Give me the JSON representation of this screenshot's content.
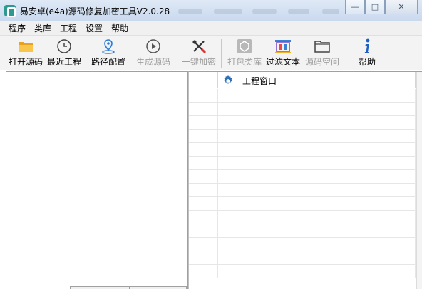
{
  "window": {
    "title": "易安卓(e4a)源码修复加密工具V2.0.28",
    "buttons": {
      "minimize": "—",
      "restore": "□",
      "close": "✕"
    }
  },
  "menu": [
    "程序",
    "类库",
    "工程",
    "设置",
    "帮助"
  ],
  "toolbar": [
    {
      "label": "打开源码",
      "icon": "folder-icon",
      "enabled": true
    },
    {
      "label": "最近工程",
      "icon": "clock-icon",
      "enabled": true
    },
    {
      "label": "路径配置",
      "icon": "location-pin-icon",
      "enabled": true
    },
    {
      "label": "生成源码",
      "icon": "play-circle-icon",
      "enabled": false
    },
    {
      "label": "一键加密",
      "icon": "tools-icon",
      "enabled": false
    },
    {
      "label": "打包类库",
      "icon": "package-icon",
      "enabled": false
    },
    {
      "label": "过滤文本",
      "icon": "filter-text-icon",
      "enabled": true
    },
    {
      "label": "源码空间",
      "icon": "folder-outline-icon",
      "enabled": false
    },
    {
      "label": "帮助",
      "icon": "info-icon",
      "enabled": true
    }
  ],
  "project_panel": {
    "header": "工程窗口",
    "header_icon": "gear-home-icon"
  },
  "colors": {
    "accent_blue": "#2a7bd6",
    "disabled_text": "#a0a0a0",
    "folder_yellow": "#f2b32a"
  }
}
